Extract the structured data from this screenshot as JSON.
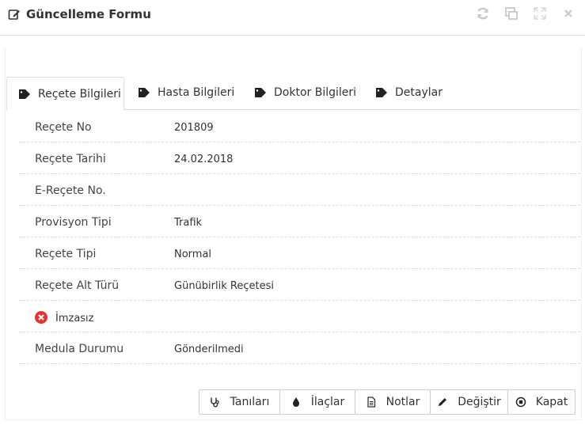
{
  "window": {
    "title": "Güncelleme Formu",
    "controls": [
      "refresh-icon",
      "restore-icon",
      "fullscreen-icon",
      "close-icon"
    ]
  },
  "tabs": [
    {
      "label": "Reçete Bilgileri",
      "active": true
    },
    {
      "label": "Hasta Bilgileri",
      "active": false
    },
    {
      "label": "Doktor Bilgileri",
      "active": false
    },
    {
      "label": "Detaylar",
      "active": false
    }
  ],
  "fields": [
    {
      "label": "Reçete No",
      "value": "201809"
    },
    {
      "label": "Reçete Tarihi",
      "value": "24.02.2018"
    },
    {
      "label": "E-Reçete No.",
      "value": ""
    },
    {
      "label": "Provisyon Tipi",
      "value": "Trafik"
    },
    {
      "label": "Reçete Tipi",
      "value": "Normal"
    },
    {
      "label": "Reçete Alt Türü",
      "value": "Günübirlik Reçetesi"
    }
  ],
  "signature": {
    "label": "İmzasız",
    "icon": "error-circle-icon",
    "color": "#e7332f"
  },
  "medula": {
    "label": "Medula Durumu",
    "value": "Gönderilmedi"
  },
  "buttons": [
    {
      "label": "Tanıları",
      "icon": "stethoscope-icon"
    },
    {
      "label": "İlaçlar",
      "icon": "drop-icon"
    },
    {
      "label": "Notlar",
      "icon": "file-icon"
    },
    {
      "label": "Değiştir",
      "icon": "pencil-icon"
    },
    {
      "label": "Kapat",
      "icon": "stop-circle-icon"
    }
  ],
  "colors": {
    "border": "#dddddd",
    "text": "#333333",
    "icon_gray": "#cccccc"
  }
}
